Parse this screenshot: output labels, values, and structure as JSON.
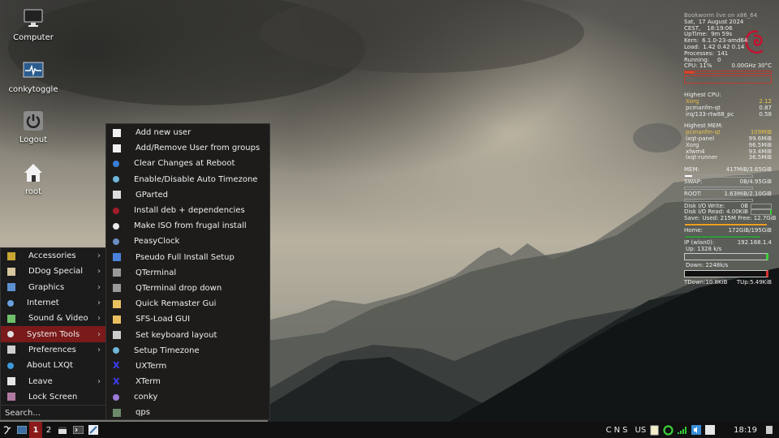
{
  "desktop": {
    "icons": [
      {
        "label": "Computer",
        "icon": "monitor-icon"
      },
      {
        "label": "conkytoggle",
        "icon": "pulse-monitor-icon"
      },
      {
        "label": "Logout",
        "icon": "power-icon"
      },
      {
        "label": "root",
        "icon": "home-icon"
      }
    ]
  },
  "conky": {
    "header": "Bookworm live on x86_64",
    "date_label": "Sat,",
    "date": "17 August 2024",
    "time_label": "CEST,",
    "time": "18:19:06",
    "uptime_label": "UpTime:",
    "uptime": "9m 59s",
    "kern_label": "Kern:",
    "kern": "6.1.0-23-amd64",
    "load_label": "Load:",
    "load": "1.42 0.42 0.14",
    "processes_label": "Processes:",
    "processes": "141",
    "running_label": "Running:",
    "running": "0",
    "cpu_label": "CPU: 11%",
    "cpu_freq": "0.00GHz 30°C",
    "cpu_percent": 11,
    "highest_cpu_title": "Highest CPU:",
    "highest_cpu": [
      {
        "name": "Xorg",
        "value": "2.12"
      },
      {
        "name": "pcmanfm-qt",
        "value": "0.87"
      },
      {
        "name": "irq/133-rtw88_pc",
        "value": "0.58"
      }
    ],
    "highest_mem_title": "Highest MEM:",
    "highest_mem": [
      {
        "name": "pcmanfm-qt",
        "value": "109MiB"
      },
      {
        "name": "lxqt-panel",
        "value": "99.6MiB"
      },
      {
        "name": "Xorg",
        "value": "96.5MiB"
      },
      {
        "name": "xfwm4",
        "value": "93.4MiB"
      },
      {
        "name": "lxqt-runner",
        "value": "36.5MiB"
      }
    ],
    "mem_label": "MEM:",
    "mem_value": "417MiB/3.65GiB",
    "mem_percent": 11,
    "swap_label": "SWAP:",
    "swap_value": "0B/4.95GiB",
    "swap_percent": 0,
    "root_label": "ROOT:",
    "root_value": "1.63MiB/2.10GiB",
    "root_percent": 0,
    "disk_write_label": "Disk I/O Write:",
    "disk_write": "0B",
    "disk_read_label": "Disk I/O Read:",
    "disk_read": "4.00KiB",
    "save_label": "Save:",
    "save_value": "Used: 215M Free: 12.7GiB",
    "save_percent": 95,
    "home_label": "Home:",
    "home_value": "172GiB/195GiB",
    "home_percent": 88,
    "ip_label": "IP (wlan0):",
    "ip": "192.168.1.4",
    "up_label": "Up: 1328 k/s",
    "down_label": "Down: 2248k/s",
    "tdown": "TDown:10.8KiB",
    "tup": "TUp:5.49KiB",
    "colors": {
      "highlight": "#e8c34a",
      "cpu_bar": "#d9472b",
      "save_bar": "#f0a020",
      "home_bar": "#2e9e3a",
      "up_graph": "#3ccf3c",
      "down_graph": "#d93030"
    }
  },
  "main_menu": {
    "items": [
      {
        "label": "Accessories",
        "icon": "accessories-icon",
        "submenu": true
      },
      {
        "label": "DDog Special",
        "icon": "ddog-icon",
        "submenu": true
      },
      {
        "label": "Graphics",
        "icon": "graphics-icon",
        "submenu": true
      },
      {
        "label": "Internet",
        "icon": "internet-icon",
        "submenu": true
      },
      {
        "label": "Sound & Video",
        "icon": "sound-video-icon",
        "submenu": true
      },
      {
        "label": "System Tools",
        "icon": "system-tools-icon",
        "submenu": true,
        "active": true
      },
      {
        "label": "Preferences",
        "icon": "preferences-icon",
        "submenu": true
      },
      {
        "label": "About LXQt",
        "icon": "lxqt-icon",
        "submenu": false
      },
      {
        "label": "Leave",
        "icon": "leave-icon",
        "submenu": true
      },
      {
        "label": "Lock Screen",
        "icon": "lock-screen-icon",
        "submenu": false
      }
    ],
    "search_placeholder": "Search...",
    "arrow": "›"
  },
  "system_tools_menu": {
    "items": [
      {
        "label": "Add new user",
        "icon": "user-house-icon"
      },
      {
        "label": "Add/Remove User from groups",
        "icon": "user-house-icon"
      },
      {
        "label": "Clear Changes at Reboot",
        "icon": "refresh-icon"
      },
      {
        "label": "Enable/Disable Auto Timezone",
        "icon": "globe-icon"
      },
      {
        "label": "GParted",
        "icon": "gparted-icon"
      },
      {
        "label": "Install deb + dependencies",
        "icon": "debian-icon"
      },
      {
        "label": "Make ISO from frugal install",
        "icon": "disc-icon"
      },
      {
        "label": "PeasyClock",
        "icon": "clock-icon"
      },
      {
        "label": "Pseudo Full Install Setup",
        "icon": "install-icon"
      },
      {
        "label": "QTerminal",
        "icon": "terminal-icon"
      },
      {
        "label": "QTerminal drop down",
        "icon": "terminal-icon"
      },
      {
        "label": "Quick Remaster Gui",
        "icon": "package-icon"
      },
      {
        "label": "SFS-Load GUI",
        "icon": "package-icon"
      },
      {
        "label": "Set keyboard layout",
        "icon": "keyboard-icon"
      },
      {
        "label": "Setup Timezone",
        "icon": "globe-icon"
      },
      {
        "label": "UXTerm",
        "icon": "x-terminal-icon"
      },
      {
        "label": "XTerm",
        "icon": "x-terminal-icon"
      },
      {
        "label": "conky",
        "icon": "conky-icon"
      },
      {
        "label": "qps",
        "icon": "qps-icon"
      }
    ]
  },
  "taskbar": {
    "workspaces": [
      "1",
      "2"
    ],
    "active_workspace": "1",
    "keyboard_indicators": [
      "C",
      "N",
      "S"
    ],
    "layout": "US",
    "clock": "18:19",
    "accent": "#8b1a1a"
  }
}
